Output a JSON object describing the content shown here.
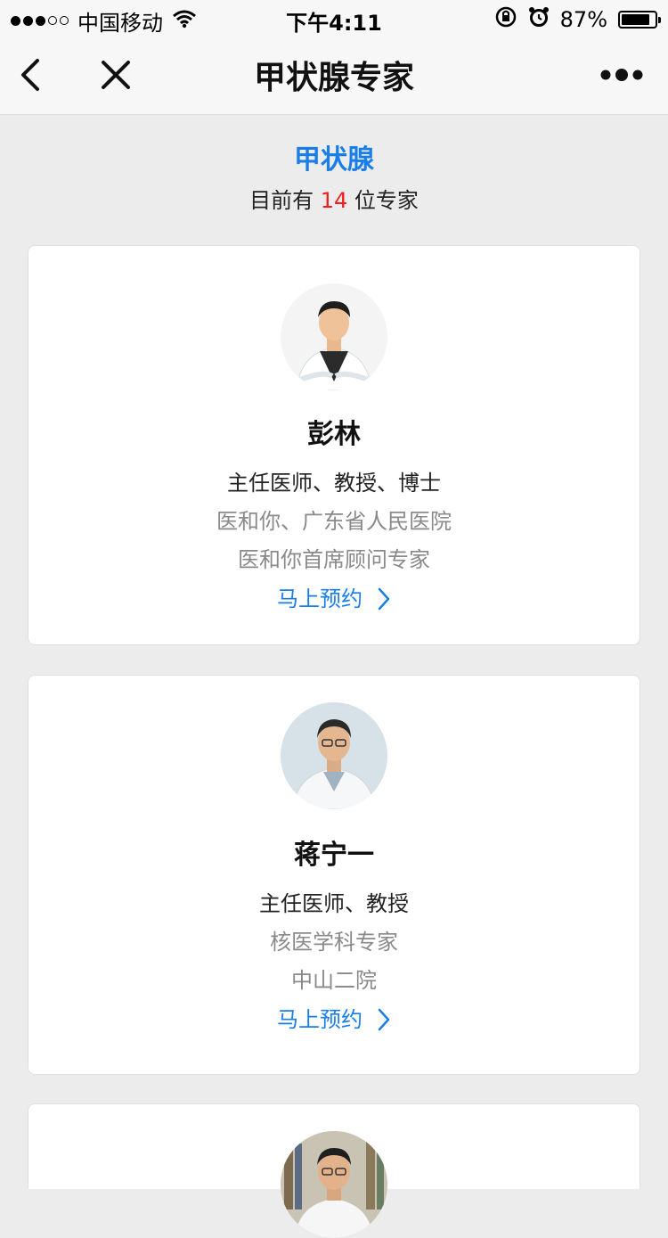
{
  "status_bar": {
    "carrier": "中国移动",
    "time": "下午4:11",
    "battery_percent": "87%",
    "battery_level": 0.87,
    "signal_icon": "signal-dots-icon",
    "wifi_icon": "wifi-icon",
    "lock_icon": "orientation-lock-icon",
    "alarm_icon": "alarm-icon"
  },
  "nav": {
    "title": "甲状腺专家",
    "back_icon": "chevron-left-icon",
    "close_icon": "close-icon",
    "more_icon": "more-dots-icon"
  },
  "section": {
    "title": "甲状腺",
    "count_prefix": "目前有",
    "count": "14",
    "count_suffix": "位专家"
  },
  "doctors": [
    {
      "name": "彭林",
      "title": "主任医师、教授、博士",
      "info1": "医和你、广东省人民医院",
      "info2": "医和你首席顾问专家",
      "book_label": "马上预约"
    },
    {
      "name": "蒋宁一",
      "title": "主任医师、教授",
      "info1": "核医学科专家",
      "info2": "中山二院",
      "book_label": "马上预约"
    },
    {
      "name": "",
      "title": "",
      "info1": "",
      "info2": "",
      "book_label": ""
    }
  ],
  "colors": {
    "accent": "#1a7ee8",
    "count_red": "#f21d1d",
    "background": "#ececec"
  }
}
